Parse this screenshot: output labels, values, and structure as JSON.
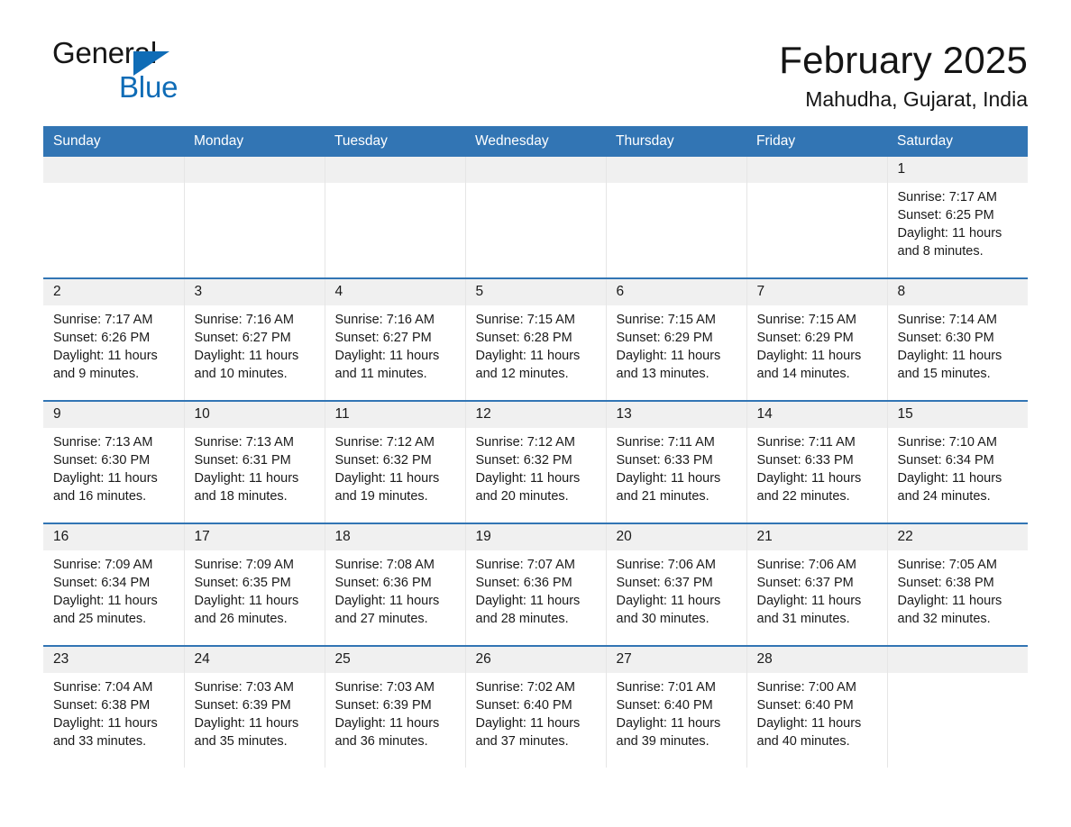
{
  "brand": {
    "name_top": "General",
    "name_bottom": "Blue",
    "accent_color": "#0f6cb6"
  },
  "header": {
    "title": "February 2025",
    "subtitle": "Mahudha, Gujarat, India"
  },
  "theme": {
    "header_blue": "#3275b4",
    "daynum_band": "#f0f0f0",
    "text": "#1a1a1a"
  },
  "weekdays": [
    "Sunday",
    "Monday",
    "Tuesday",
    "Wednesday",
    "Thursday",
    "Friday",
    "Saturday"
  ],
  "labels": {
    "sunrise_prefix": "Sunrise:",
    "sunset_prefix": "Sunset:",
    "daylight_prefix": "Daylight:"
  },
  "weeks": [
    [
      {
        "day": "",
        "sunrise": "",
        "sunset": "",
        "daylight": ""
      },
      {
        "day": "",
        "sunrise": "",
        "sunset": "",
        "daylight": ""
      },
      {
        "day": "",
        "sunrise": "",
        "sunset": "",
        "daylight": ""
      },
      {
        "day": "",
        "sunrise": "",
        "sunset": "",
        "daylight": ""
      },
      {
        "day": "",
        "sunrise": "",
        "sunset": "",
        "daylight": ""
      },
      {
        "day": "",
        "sunrise": "",
        "sunset": "",
        "daylight": ""
      },
      {
        "day": "1",
        "sunrise": "Sunrise: 7:17 AM",
        "sunset": "Sunset: 6:25 PM",
        "daylight": "Daylight: 11 hours and 8 minutes."
      }
    ],
    [
      {
        "day": "2",
        "sunrise": "Sunrise: 7:17 AM",
        "sunset": "Sunset: 6:26 PM",
        "daylight": "Daylight: 11 hours and 9 minutes."
      },
      {
        "day": "3",
        "sunrise": "Sunrise: 7:16 AM",
        "sunset": "Sunset: 6:27 PM",
        "daylight": "Daylight: 11 hours and 10 minutes."
      },
      {
        "day": "4",
        "sunrise": "Sunrise: 7:16 AM",
        "sunset": "Sunset: 6:27 PM",
        "daylight": "Daylight: 11 hours and 11 minutes."
      },
      {
        "day": "5",
        "sunrise": "Sunrise: 7:15 AM",
        "sunset": "Sunset: 6:28 PM",
        "daylight": "Daylight: 11 hours and 12 minutes."
      },
      {
        "day": "6",
        "sunrise": "Sunrise: 7:15 AM",
        "sunset": "Sunset: 6:29 PM",
        "daylight": "Daylight: 11 hours and 13 minutes."
      },
      {
        "day": "7",
        "sunrise": "Sunrise: 7:15 AM",
        "sunset": "Sunset: 6:29 PM",
        "daylight": "Daylight: 11 hours and 14 minutes."
      },
      {
        "day": "8",
        "sunrise": "Sunrise: 7:14 AM",
        "sunset": "Sunset: 6:30 PM",
        "daylight": "Daylight: 11 hours and 15 minutes."
      }
    ],
    [
      {
        "day": "9",
        "sunrise": "Sunrise: 7:13 AM",
        "sunset": "Sunset: 6:30 PM",
        "daylight": "Daylight: 11 hours and 16 minutes."
      },
      {
        "day": "10",
        "sunrise": "Sunrise: 7:13 AM",
        "sunset": "Sunset: 6:31 PM",
        "daylight": "Daylight: 11 hours and 18 minutes."
      },
      {
        "day": "11",
        "sunrise": "Sunrise: 7:12 AM",
        "sunset": "Sunset: 6:32 PM",
        "daylight": "Daylight: 11 hours and 19 minutes."
      },
      {
        "day": "12",
        "sunrise": "Sunrise: 7:12 AM",
        "sunset": "Sunset: 6:32 PM",
        "daylight": "Daylight: 11 hours and 20 minutes."
      },
      {
        "day": "13",
        "sunrise": "Sunrise: 7:11 AM",
        "sunset": "Sunset: 6:33 PM",
        "daylight": "Daylight: 11 hours and 21 minutes."
      },
      {
        "day": "14",
        "sunrise": "Sunrise: 7:11 AM",
        "sunset": "Sunset: 6:33 PM",
        "daylight": "Daylight: 11 hours and 22 minutes."
      },
      {
        "day": "15",
        "sunrise": "Sunrise: 7:10 AM",
        "sunset": "Sunset: 6:34 PM",
        "daylight": "Daylight: 11 hours and 24 minutes."
      }
    ],
    [
      {
        "day": "16",
        "sunrise": "Sunrise: 7:09 AM",
        "sunset": "Sunset: 6:34 PM",
        "daylight": "Daylight: 11 hours and 25 minutes."
      },
      {
        "day": "17",
        "sunrise": "Sunrise: 7:09 AM",
        "sunset": "Sunset: 6:35 PM",
        "daylight": "Daylight: 11 hours and 26 minutes."
      },
      {
        "day": "18",
        "sunrise": "Sunrise: 7:08 AM",
        "sunset": "Sunset: 6:36 PM",
        "daylight": "Daylight: 11 hours and 27 minutes."
      },
      {
        "day": "19",
        "sunrise": "Sunrise: 7:07 AM",
        "sunset": "Sunset: 6:36 PM",
        "daylight": "Daylight: 11 hours and 28 minutes."
      },
      {
        "day": "20",
        "sunrise": "Sunrise: 7:06 AM",
        "sunset": "Sunset: 6:37 PM",
        "daylight": "Daylight: 11 hours and 30 minutes."
      },
      {
        "day": "21",
        "sunrise": "Sunrise: 7:06 AM",
        "sunset": "Sunset: 6:37 PM",
        "daylight": "Daylight: 11 hours and 31 minutes."
      },
      {
        "day": "22",
        "sunrise": "Sunrise: 7:05 AM",
        "sunset": "Sunset: 6:38 PM",
        "daylight": "Daylight: 11 hours and 32 minutes."
      }
    ],
    [
      {
        "day": "23",
        "sunrise": "Sunrise: 7:04 AM",
        "sunset": "Sunset: 6:38 PM",
        "daylight": "Daylight: 11 hours and 33 minutes."
      },
      {
        "day": "24",
        "sunrise": "Sunrise: 7:03 AM",
        "sunset": "Sunset: 6:39 PM",
        "daylight": "Daylight: 11 hours and 35 minutes."
      },
      {
        "day": "25",
        "sunrise": "Sunrise: 7:03 AM",
        "sunset": "Sunset: 6:39 PM",
        "daylight": "Daylight: 11 hours and 36 minutes."
      },
      {
        "day": "26",
        "sunrise": "Sunrise: 7:02 AM",
        "sunset": "Sunset: 6:40 PM",
        "daylight": "Daylight: 11 hours and 37 minutes."
      },
      {
        "day": "27",
        "sunrise": "Sunrise: 7:01 AM",
        "sunset": "Sunset: 6:40 PM",
        "daylight": "Daylight: 11 hours and 39 minutes."
      },
      {
        "day": "28",
        "sunrise": "Sunrise: 7:00 AM",
        "sunset": "Sunset: 6:40 PM",
        "daylight": "Daylight: 11 hours and 40 minutes."
      },
      {
        "day": "",
        "sunrise": "",
        "sunset": "",
        "daylight": ""
      }
    ]
  ]
}
